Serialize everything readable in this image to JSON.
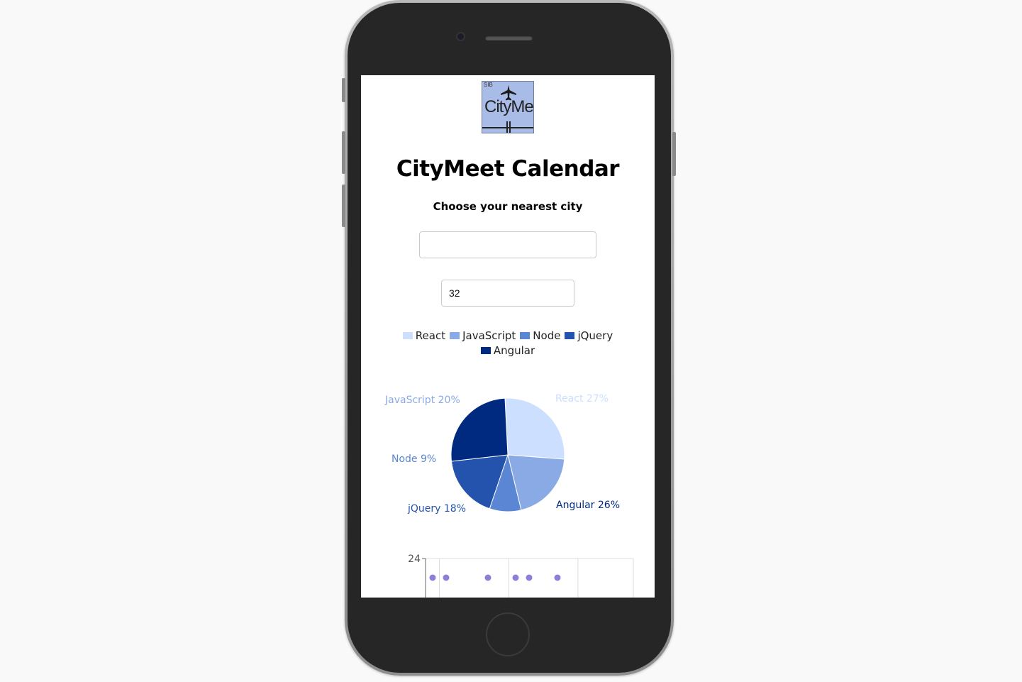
{
  "app": {
    "logo": {
      "small_text": "SIB",
      "text": "CityMeet"
    },
    "title": "CityMeet Calendar",
    "subtitle": "Choose your nearest city"
  },
  "inputs": {
    "city": {
      "value": "",
      "placeholder": ""
    },
    "number_of_events": {
      "value": "32"
    }
  },
  "colors": {
    "React": "#cddfff",
    "JavaScript": "#8aaae5",
    "Node": "#5a86d3",
    "jQuery": "#2453ae",
    "Angular": "#002a7f",
    "scatter_point": "#8b80d6"
  },
  "chart_data": [
    {
      "type": "pie",
      "legend_position": "top",
      "slices": [
        {
          "name": "React",
          "percent": 27,
          "label": "React 27%"
        },
        {
          "name": "JavaScript",
          "percent": 20,
          "label": "JavaScript 20%"
        },
        {
          "name": "Node",
          "percent": 9,
          "label": "Node 9%"
        },
        {
          "name": "jQuery",
          "percent": 18,
          "label": "jQuery 18%"
        },
        {
          "name": "Angular",
          "percent": 26,
          "label": "Angular 26%"
        }
      ]
    },
    {
      "type": "scatter",
      "ylim": [
        0,
        24
      ],
      "y_ticks": [
        24
      ],
      "points": [
        {
          "x": 1,
          "y": 21
        },
        {
          "x": 2,
          "y": 21
        },
        {
          "x": 5,
          "y": 21
        },
        {
          "x": 7,
          "y": 21
        },
        {
          "x": 8,
          "y": 21
        },
        {
          "x": 10,
          "y": 21
        }
      ],
      "xlim": [
        0.5,
        15.5
      ],
      "grid": true
    }
  ]
}
